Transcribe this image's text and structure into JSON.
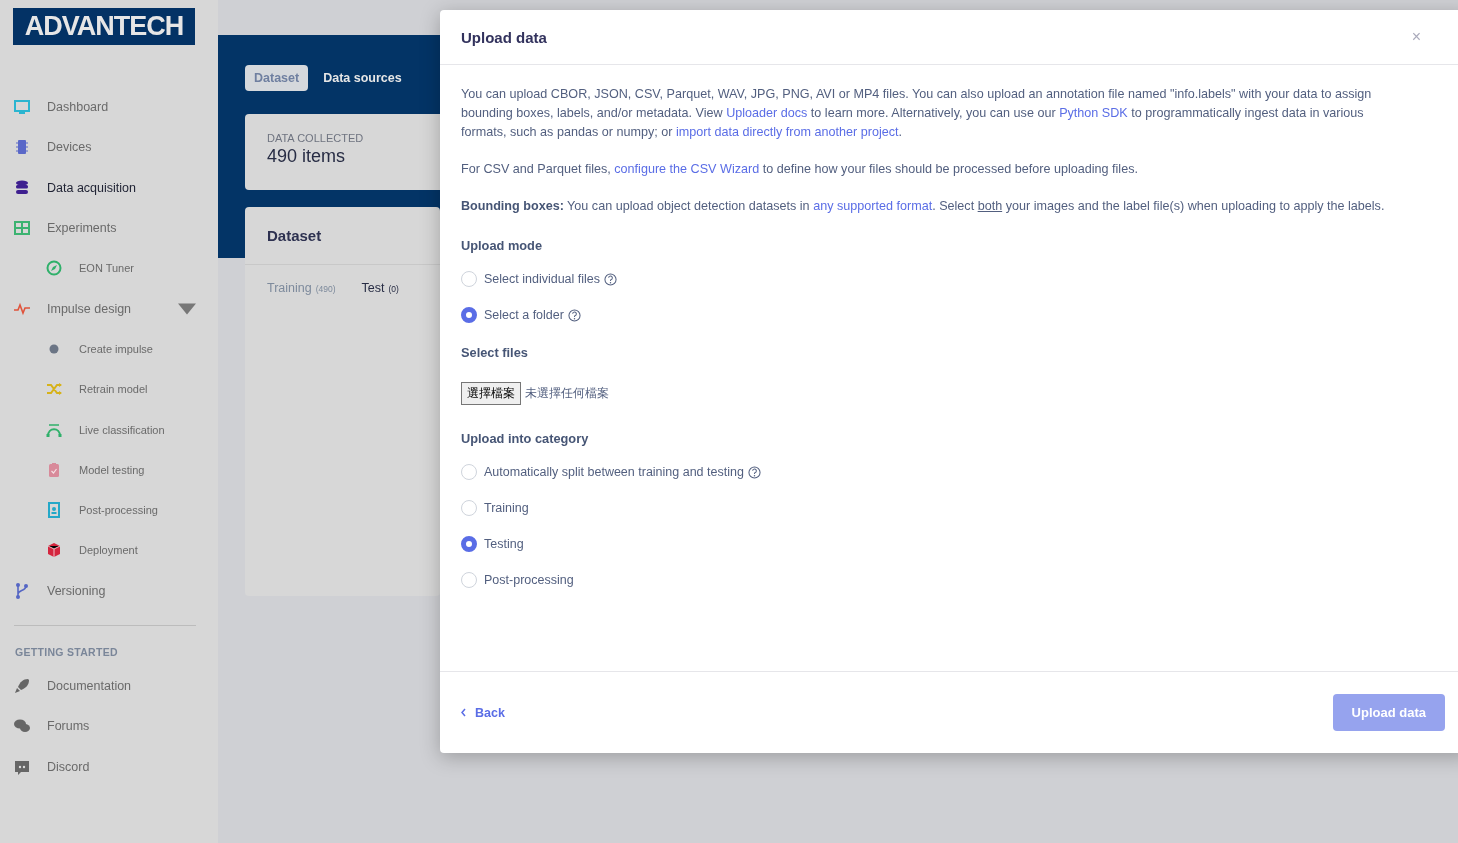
{
  "logo": "ADVANTECH",
  "sidebar": {
    "items": [
      {
        "label": "Dashboard",
        "selected": false
      },
      {
        "label": "Devices",
        "selected": false
      },
      {
        "label": "Data acquisition",
        "selected": true
      },
      {
        "label": "Experiments",
        "selected": false,
        "children": [
          {
            "label": "EON Tuner",
            "selected": false
          }
        ]
      },
      {
        "label": "Impulse design",
        "selected": false,
        "expanded": true,
        "children": [
          {
            "label": "Create impulse",
            "selected": false
          },
          {
            "label": "Retrain model",
            "selected": false
          },
          {
            "label": "Live classification",
            "selected": false
          },
          {
            "label": "Model testing",
            "selected": false
          },
          {
            "label": "Post-processing",
            "selected": false
          },
          {
            "label": "Deployment",
            "selected": false
          }
        ]
      },
      {
        "label": "Versioning",
        "selected": false
      }
    ],
    "section_title": "GETTING STARTED",
    "links": [
      {
        "label": "Documentation"
      },
      {
        "label": "Forums"
      },
      {
        "label": "Discord"
      }
    ]
  },
  "tabs": [
    {
      "label": "Dataset",
      "selected": true
    },
    {
      "label": "Data sources",
      "selected": false
    }
  ],
  "summary": {
    "label": "DATA COLLECTED",
    "value": "490 items"
  },
  "dataset": {
    "title": "Dataset",
    "tabs": [
      {
        "label": "Training",
        "count": "(490)",
        "selected": false
      },
      {
        "label": "Test",
        "count": "(0)",
        "selected": true
      }
    ]
  },
  "modal": {
    "title": "Upload data",
    "close": "×",
    "paragraphs": [
      [
        {
          "kind": "text",
          "text": "You can upload CBOR, JSON, CSV, Parquet, WAV, JPG, PNG, AVI or MP4 files. You can also upload an annotation file named \"info.labels\" with your data to assign bounding boxes, labels, and/or metadata. View "
        },
        {
          "kind": "link",
          "text": "Uploader docs"
        },
        {
          "kind": "text",
          "text": " to learn more. Alternatively, you can use our "
        },
        {
          "kind": "link",
          "text": "Python SDK"
        },
        {
          "kind": "text",
          "text": " to programmatically ingest data in various formats, such as pandas or numpy; or "
        },
        {
          "kind": "link",
          "text": "import data directly from another project"
        },
        {
          "kind": "text",
          "text": "."
        }
      ],
      [
        {
          "kind": "text",
          "text": "For CSV and Parquet files, "
        },
        {
          "kind": "link",
          "text": "configure the CSV Wizard"
        },
        {
          "kind": "text",
          "text": " to define how your files should be processed before uploading files."
        }
      ],
      [
        {
          "kind": "bold",
          "text": "Bounding boxes:"
        },
        {
          "kind": "text",
          "text": " You can upload object detection datasets in "
        },
        {
          "kind": "link",
          "text": "any supported format"
        },
        {
          "kind": "text",
          "text": ". Select "
        },
        {
          "kind": "underline",
          "text": "both"
        },
        {
          "kind": "text",
          "text": " your images and the label file(s) when uploading to apply the labels."
        }
      ]
    ],
    "upload_mode": {
      "title": "Upload mode",
      "options": [
        {
          "label": "Select individual files",
          "help": true,
          "selected": false
        },
        {
          "label": "Select a folder",
          "help": true,
          "selected": true
        }
      ]
    },
    "select_files": {
      "title": "Select files",
      "button": "選擇檔案",
      "status": "未選擇任何檔案"
    },
    "category": {
      "title": "Upload into category",
      "options": [
        {
          "label": "Automatically split between training and testing",
          "help": true,
          "selected": false
        },
        {
          "label": "Training",
          "help": false,
          "selected": false
        },
        {
          "label": "Testing",
          "help": false,
          "selected": true
        },
        {
          "label": "Post-processing",
          "help": false,
          "selected": false
        }
      ]
    },
    "back": "Back",
    "submit": {
      "label": "Upload data",
      "disabled": true
    }
  }
}
